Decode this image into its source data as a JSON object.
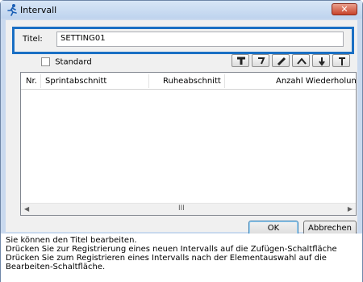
{
  "window": {
    "title": "Intervall",
    "close_symbol": "✕"
  },
  "form": {
    "title_label": "Titel:",
    "title_value": "SETTING01",
    "standard_label": "Standard",
    "standard_checked": false
  },
  "toolbar": {
    "buttons": [
      "add-icon",
      "arrow-right-icon",
      "edit-icon",
      "move-up-icon",
      "move-down-icon",
      "move-top-icon"
    ]
  },
  "list": {
    "columns": [
      "Nr.",
      "Sprintabschnitt",
      "Ruheabschnitt",
      "Anzahl Wiederholungen"
    ],
    "rows": [],
    "scroll_grip": "III"
  },
  "buttons": {
    "ok": "OK",
    "cancel": "Abbrechen"
  },
  "help": {
    "lines": [
      "Sie können den Titel bearbeiten.",
      "Drücken Sie zur Registrierung eines neuen Intervalls auf die Zufügen-Schaltfläche",
      "Drücken Sie zum Registrieren eines Intervalls nach der Elementauswahl auf die",
      "Bearbeiten-Schaltfläche."
    ]
  }
}
